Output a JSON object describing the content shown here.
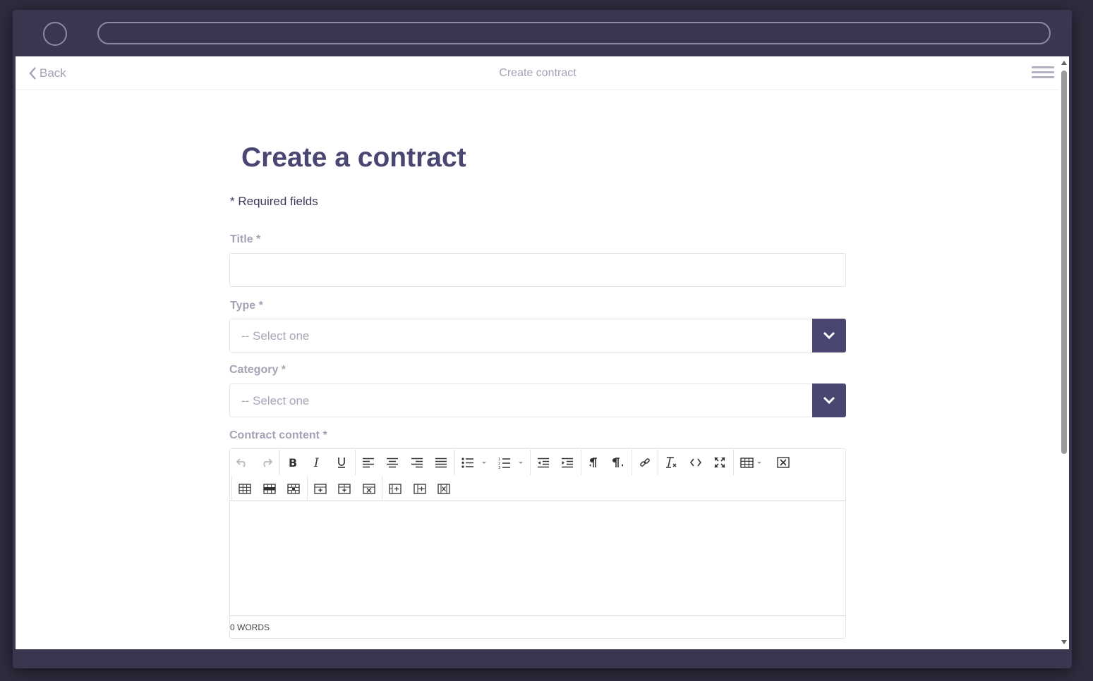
{
  "nav": {
    "back_label": "Back",
    "title": "Create contract"
  },
  "page": {
    "heading": "Create a contract",
    "required_note": "* Required fields"
  },
  "form": {
    "title_label": "Title *",
    "title_value": "",
    "type_label": "Type *",
    "type_value": "-- Select one",
    "category_label": "Category *",
    "category_value": "-- Select one",
    "content_label": "Contract content *",
    "word_count": "0 WORDS"
  },
  "editor_toolbar": {
    "row1": [
      "undo-icon",
      "redo-icon",
      "bold-icon",
      "italic-icon",
      "underline-icon",
      "align-left-icon",
      "align-center-icon",
      "align-right-icon",
      "align-justify-icon",
      "bullet-list-icon",
      "numbered-list-icon",
      "outdent-icon",
      "indent-icon",
      "ltr-icon",
      "rtl-icon",
      "link-icon",
      "clear-format-icon",
      "code-icon",
      "fullscreen-icon",
      "table-icon",
      "remove-icon"
    ],
    "row2": [
      "table-props-icon",
      "row-insert-before-icon",
      "row-insert-after-icon",
      "row-delete-icon",
      "col-insert-before-icon",
      "col-insert-after-icon",
      "col-delete-icon",
      "cell-split-icon",
      "cell-merge-icon",
      "table-delete-icon"
    ]
  },
  "colors": {
    "brand": "#4a4672",
    "label": "#a5a2b6",
    "frame": "#3a3650"
  }
}
